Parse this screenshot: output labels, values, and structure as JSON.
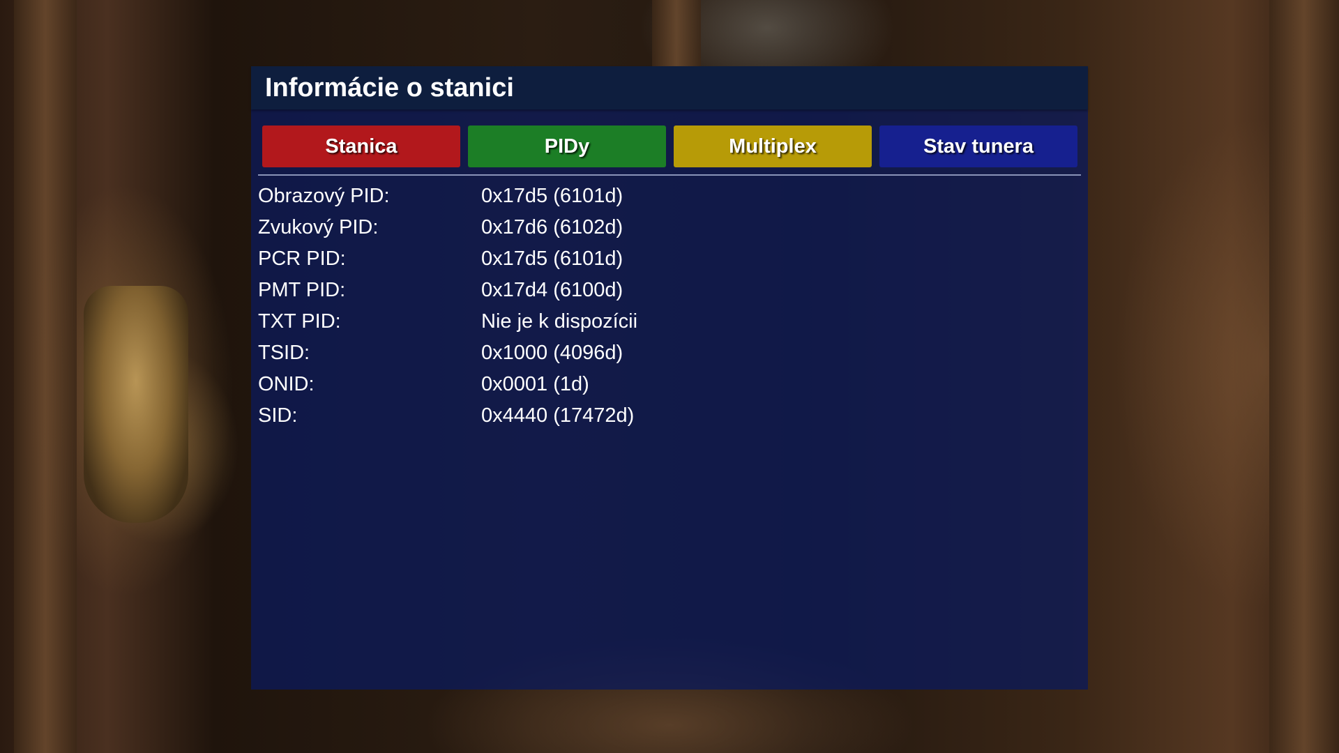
{
  "window": {
    "title": "Informácie o stanici"
  },
  "tabs": [
    {
      "label": "Stanica",
      "color": "#b2181c"
    },
    {
      "label": "PIDy",
      "color": "#1c7e26"
    },
    {
      "label": "Multiplex",
      "color": "#b79b07"
    },
    {
      "label": "Stav tunera",
      "color": "#16208f"
    }
  ],
  "info": [
    {
      "label": "Obrazový PID:",
      "value": "0x17d5 (6101d)"
    },
    {
      "label": "Zvukový PID:",
      "value": "0x17d6 (6102d)"
    },
    {
      "label": "PCR PID:",
      "value": "0x17d5 (6101d)"
    },
    {
      "label": "PMT PID:",
      "value": "0x17d4 (6100d)"
    },
    {
      "label": "TXT PID:",
      "value": "Nie je k dispozícii"
    },
    {
      "label": "TSID:",
      "value": "0x1000 (4096d)"
    },
    {
      "label": "ONID:",
      "value": "0x0001 (1d)"
    },
    {
      "label": "SID:",
      "value": "0x4440 (17472d)"
    }
  ],
  "colors": {
    "panel_bg": "#0c1a58",
    "header_bg": "#0e1e3e",
    "text": "#ffffff"
  }
}
